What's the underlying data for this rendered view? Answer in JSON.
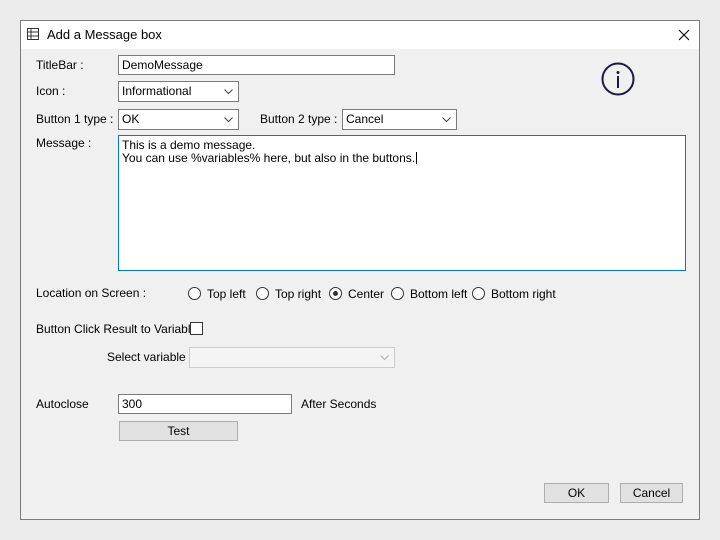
{
  "window": {
    "title": "Add a Message box",
    "icon": "grid-table-icon"
  },
  "form": {
    "titlebar_label": "TitleBar :",
    "titlebar_value": "DemoMessage",
    "icon_label": "Icon :",
    "icon_value": "Informational",
    "button1_label": "Button 1 type :",
    "button1_value": "OK",
    "button2_label": "Button 2 type :",
    "button2_value": "Cancel",
    "message_label": "Message :",
    "message_lines": [
      "This is a demo message.",
      "You can use %variables% here, but also in the buttons."
    ],
    "preview_icon": "info-circle-icon",
    "location_label": "Location on Screen :",
    "location_options": [
      "Top left",
      "Top right",
      "Center",
      "Bottom left",
      "Bottom right"
    ],
    "location_selected": "Center",
    "click_result_label": "Button Click Result to Variable",
    "click_result_checked": false,
    "select_variable_label": "Select variable",
    "select_variable_value": "",
    "autoclose_label": "Autoclose",
    "autoclose_value": "300",
    "after_seconds_label": "After Seconds",
    "test_button": "Test"
  },
  "footer": {
    "ok": "OK",
    "cancel": "Cancel"
  }
}
